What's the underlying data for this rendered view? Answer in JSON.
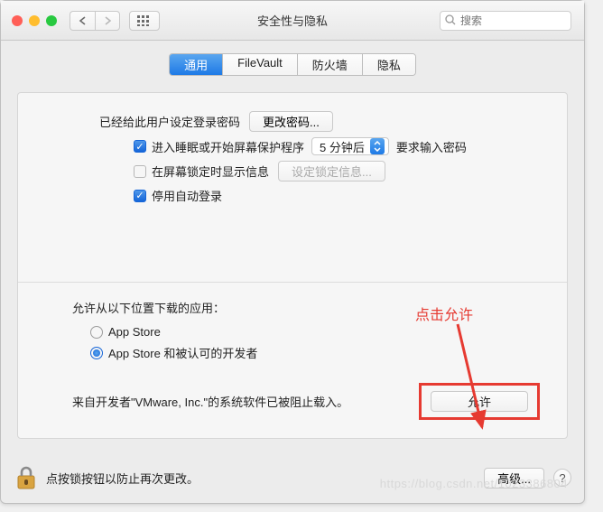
{
  "window": {
    "title": "安全性与隐私"
  },
  "search": {
    "placeholder": "搜索"
  },
  "tabs": [
    {
      "label": "通用",
      "active": true
    },
    {
      "label": "FileVault",
      "active": false
    },
    {
      "label": "防火墙",
      "active": false
    },
    {
      "label": "隐私",
      "active": false
    }
  ],
  "password": {
    "intro": "已经给此用户设定登录密码",
    "change_btn": "更改密码..."
  },
  "sleep": {
    "prefix": "进入睡眠或开始屏幕保护程序",
    "popup": "5 分钟后",
    "suffix": "要求输入密码",
    "checked": true
  },
  "lock_msg": {
    "label": "在屏幕锁定时显示信息",
    "btn": "设定锁定信息...",
    "checked": false
  },
  "auto_login": {
    "label": "停用自动登录",
    "checked": true
  },
  "sources": {
    "heading": "允许从以下位置下载的应用：",
    "opt1": "App Store",
    "opt2": "App Store 和被认可的开发者",
    "selected": 2
  },
  "blocked": {
    "text": "来自开发者\"VMware, Inc.\"的系统软件已被阻止载入。",
    "allow_btn": "允许"
  },
  "annotation": "点击允许",
  "footer": {
    "text": "点按锁按钮以防止再次更改。",
    "advanced_btn": "高级...",
    "help": "?"
  },
  "watermark": "https://blog.csdn.net/1023386804",
  "colors": {
    "accent": "#1e7ae6",
    "annotation": "#e63a31"
  }
}
